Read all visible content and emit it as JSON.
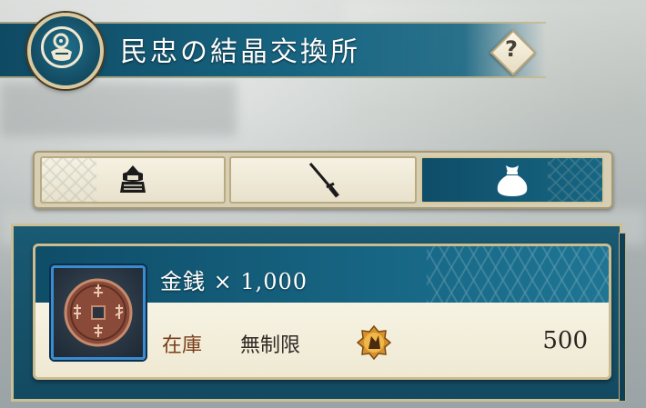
{
  "header": {
    "title": "民忠の結晶交換所",
    "emblem_icon": "crystal-exchange-icon",
    "help_label": "?"
  },
  "tabs": [
    {
      "name": "armor",
      "icon": "samurai-armor-icon",
      "active": false
    },
    {
      "name": "weapon",
      "icon": "katana-icon",
      "active": false
    },
    {
      "name": "items",
      "icon": "money-bag-icon",
      "active": true
    }
  ],
  "items": [
    {
      "name": "金銭 × 1,000",
      "icon": "ancient-coin-icon",
      "stock_label": "在庫",
      "stock_value": "無制限",
      "price_icon": "loyalty-crystal-icon",
      "price": "500"
    }
  ],
  "colors": {
    "accent_teal": "#176582",
    "gold_border": "#cdbf95",
    "stock_label": "#7a3e18"
  }
}
